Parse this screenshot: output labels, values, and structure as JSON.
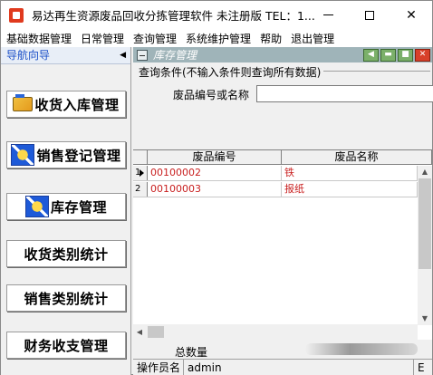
{
  "window": {
    "title": "易达再生资源废品回收分拣管理软件  未注册版  TEL：1...",
    "controls": {
      "minimize": "minimize",
      "maximize": "maximize",
      "close": "✕"
    }
  },
  "menu": [
    {
      "label": "基础数据管理"
    },
    {
      "label": "日常管理"
    },
    {
      "label": "查询管理"
    },
    {
      "label": "系统维护管理"
    },
    {
      "label": "帮助"
    },
    {
      "label": "退出管理"
    }
  ],
  "nav": {
    "header": "导航向导",
    "collapse_glyph": "◀",
    "items": [
      {
        "label": "收货入库管理",
        "icon": "folder-icon"
      },
      {
        "label": "销售登记管理",
        "icon": "star-doc-icon"
      },
      {
        "label": "库存管理",
        "icon": "star-doc-icon"
      },
      {
        "label": "收货类别统计",
        "icon": ""
      },
      {
        "label": "销售类别统计",
        "icon": ""
      },
      {
        "label": "财务收支管理",
        "icon": ""
      }
    ]
  },
  "panel": {
    "title": "库存管理",
    "buttons": [
      "◀",
      "▬",
      "■",
      "✕"
    ],
    "query": {
      "legend": "查询条件(不输入条件则查询所有数据)",
      "field_label": "废品编号或名称",
      "field_value": "",
      "field_placeholder": ""
    },
    "grid": {
      "columns": [
        "废品编号",
        "废品名称"
      ],
      "rows": [
        {
          "index": "1",
          "code": "00100002",
          "name": "铁"
        },
        {
          "index": "2",
          "code": "00100003",
          "name": "报纸"
        }
      ]
    },
    "total": {
      "label": "总数量",
      "value": ""
    }
  },
  "status": {
    "operator_label": "操作员名",
    "operator_value": "admin",
    "tail": "E"
  },
  "colors": {
    "accent": "#1c50c8",
    "panel_title_bg": "#9fb4b9",
    "grid_text": "#c81e1e"
  }
}
